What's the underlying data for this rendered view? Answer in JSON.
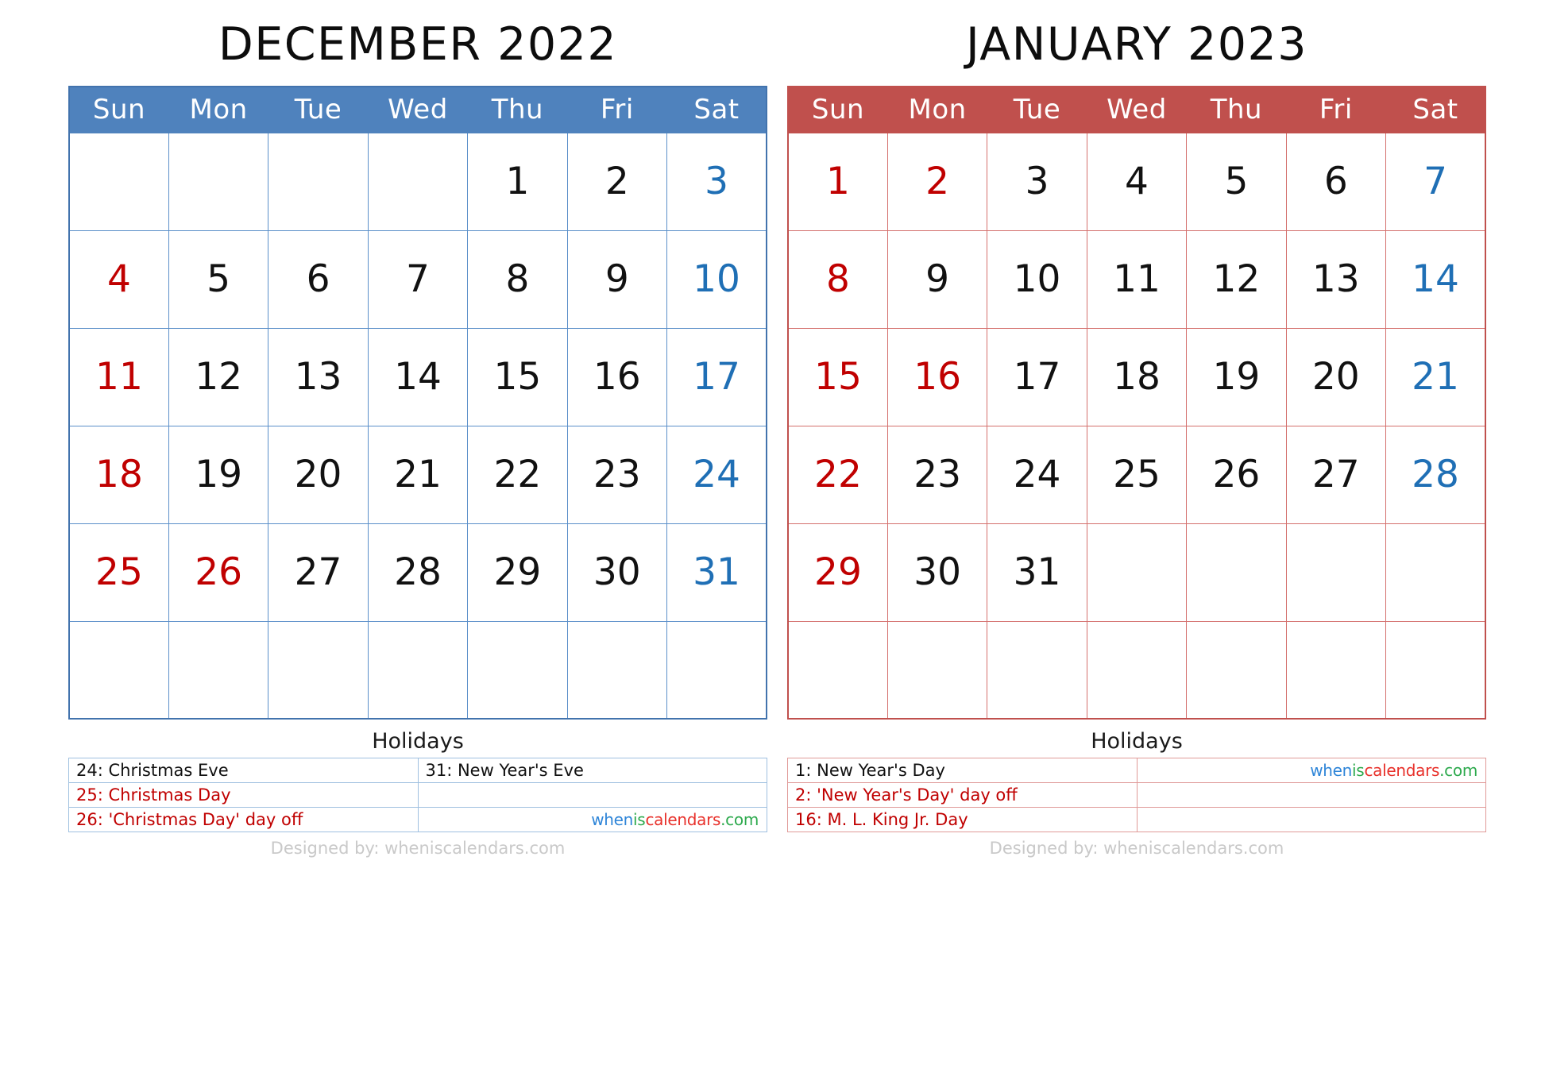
{
  "colors": {
    "december_accent": "#4f82bd",
    "january_accent": "#c0504d",
    "sunday": "#c00000",
    "saturday": "#1f6fb5",
    "weekday": "#111111",
    "holiday": "#c00000"
  },
  "logo": {
    "part1": "when",
    "part2": "is",
    "part3": "calendars",
    "part4": ".com"
  },
  "footer": {
    "designed_by": "Designed by: wheniscalendars.com"
  },
  "months": [
    {
      "title": "DECEMBER 2022",
      "accent": "#4f82bd",
      "weekdays": [
        "Sun",
        "Mon",
        "Tue",
        "Wed",
        "Thu",
        "Fri",
        "Sat"
      ],
      "weeks": [
        [
          {
            "day": "",
            "style": "empty"
          },
          {
            "day": "",
            "style": "empty"
          },
          {
            "day": "",
            "style": "empty"
          },
          {
            "day": "",
            "style": "empty"
          },
          {
            "day": "1",
            "style": "normal"
          },
          {
            "day": "2",
            "style": "normal"
          },
          {
            "day": "3",
            "style": "sat"
          }
        ],
        [
          {
            "day": "4",
            "style": "sun"
          },
          {
            "day": "5",
            "style": "normal"
          },
          {
            "day": "6",
            "style": "normal"
          },
          {
            "day": "7",
            "style": "normal"
          },
          {
            "day": "8",
            "style": "normal"
          },
          {
            "day": "9",
            "style": "normal"
          },
          {
            "day": "10",
            "style": "sat"
          }
        ],
        [
          {
            "day": "11",
            "style": "sun"
          },
          {
            "day": "12",
            "style": "normal"
          },
          {
            "day": "13",
            "style": "normal"
          },
          {
            "day": "14",
            "style": "normal"
          },
          {
            "day": "15",
            "style": "normal"
          },
          {
            "day": "16",
            "style": "normal"
          },
          {
            "day": "17",
            "style": "sat"
          }
        ],
        [
          {
            "day": "18",
            "style": "sun"
          },
          {
            "day": "19",
            "style": "normal"
          },
          {
            "day": "20",
            "style": "normal"
          },
          {
            "day": "21",
            "style": "normal"
          },
          {
            "day": "22",
            "style": "normal"
          },
          {
            "day": "23",
            "style": "normal"
          },
          {
            "day": "24",
            "style": "sat"
          }
        ],
        [
          {
            "day": "25",
            "style": "sun"
          },
          {
            "day": "26",
            "style": "hol"
          },
          {
            "day": "27",
            "style": "normal"
          },
          {
            "day": "28",
            "style": "normal"
          },
          {
            "day": "29",
            "style": "normal"
          },
          {
            "day": "30",
            "style": "normal"
          },
          {
            "day": "31",
            "style": "sat"
          }
        ],
        [
          {
            "day": "",
            "style": "empty"
          },
          {
            "day": "",
            "style": "empty"
          },
          {
            "day": "",
            "style": "empty"
          },
          {
            "day": "",
            "style": "empty"
          },
          {
            "day": "",
            "style": "empty"
          },
          {
            "day": "",
            "style": "empty"
          },
          {
            "day": "",
            "style": "empty"
          }
        ]
      ],
      "holidays_title": "Holidays",
      "holidays_rows": [
        {
          "left": "24: Christmas Eve",
          "left_color": "black",
          "right": "31: New Year's Eve",
          "right_color": "black",
          "right_logo": false
        },
        {
          "left": "25: Christmas Day",
          "left_color": "red",
          "right": "",
          "right_color": "black",
          "right_logo": false
        },
        {
          "left": "26: 'Christmas Day' day off",
          "left_color": "red",
          "right": "",
          "right_color": "black",
          "right_logo": true
        }
      ]
    },
    {
      "title": "JANUARY 2023",
      "accent": "#c0504d",
      "weekdays": [
        "Sun",
        "Mon",
        "Tue",
        "Wed",
        "Thu",
        "Fri",
        "Sat"
      ],
      "weeks": [
        [
          {
            "day": "1",
            "style": "sun"
          },
          {
            "day": "2",
            "style": "hol"
          },
          {
            "day": "3",
            "style": "normal"
          },
          {
            "day": "4",
            "style": "normal"
          },
          {
            "day": "5",
            "style": "normal"
          },
          {
            "day": "6",
            "style": "normal"
          },
          {
            "day": "7",
            "style": "sat"
          }
        ],
        [
          {
            "day": "8",
            "style": "sun"
          },
          {
            "day": "9",
            "style": "normal"
          },
          {
            "day": "10",
            "style": "normal"
          },
          {
            "day": "11",
            "style": "normal"
          },
          {
            "day": "12",
            "style": "normal"
          },
          {
            "day": "13",
            "style": "normal"
          },
          {
            "day": "14",
            "style": "sat"
          }
        ],
        [
          {
            "day": "15",
            "style": "sun"
          },
          {
            "day": "16",
            "style": "hol"
          },
          {
            "day": "17",
            "style": "normal"
          },
          {
            "day": "18",
            "style": "normal"
          },
          {
            "day": "19",
            "style": "normal"
          },
          {
            "day": "20",
            "style": "normal"
          },
          {
            "day": "21",
            "style": "sat"
          }
        ],
        [
          {
            "day": "22",
            "style": "sun"
          },
          {
            "day": "23",
            "style": "normal"
          },
          {
            "day": "24",
            "style": "normal"
          },
          {
            "day": "25",
            "style": "normal"
          },
          {
            "day": "26",
            "style": "normal"
          },
          {
            "day": "27",
            "style": "normal"
          },
          {
            "day": "28",
            "style": "sat"
          }
        ],
        [
          {
            "day": "29",
            "style": "sun"
          },
          {
            "day": "30",
            "style": "normal"
          },
          {
            "day": "31",
            "style": "normal"
          },
          {
            "day": "",
            "style": "empty"
          },
          {
            "day": "",
            "style": "empty"
          },
          {
            "day": "",
            "style": "empty"
          },
          {
            "day": "",
            "style": "empty"
          }
        ],
        [
          {
            "day": "",
            "style": "empty"
          },
          {
            "day": "",
            "style": "empty"
          },
          {
            "day": "",
            "style": "empty"
          },
          {
            "day": "",
            "style": "empty"
          },
          {
            "day": "",
            "style": "empty"
          },
          {
            "day": "",
            "style": "empty"
          },
          {
            "day": "",
            "style": "empty"
          }
        ]
      ],
      "holidays_title": "Holidays",
      "holidays_rows": [
        {
          "left": "1: New Year's Day",
          "left_color": "black",
          "right": "",
          "right_color": "black",
          "right_logo": true
        },
        {
          "left": "2: 'New Year's Day' day off",
          "left_color": "red",
          "right": "",
          "right_color": "black",
          "right_logo": false
        },
        {
          "left": "16: M. L. King Jr. Day",
          "left_color": "red",
          "right": "",
          "right_color": "black",
          "right_logo": false
        }
      ]
    }
  ]
}
